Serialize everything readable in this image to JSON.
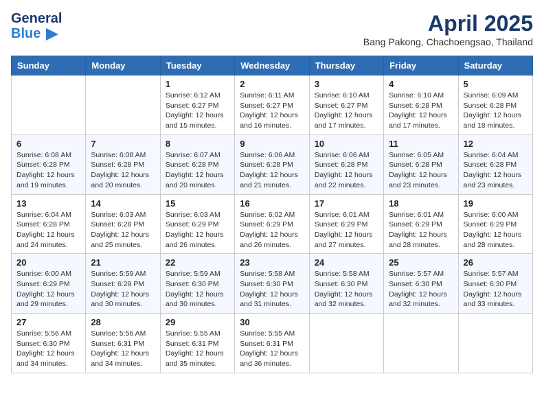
{
  "header": {
    "logo_general": "General",
    "logo_blue": "Blue",
    "title": "April 2025",
    "subtitle": "Bang Pakong, Chachoengsao, Thailand"
  },
  "weekdays": [
    "Sunday",
    "Monday",
    "Tuesday",
    "Wednesday",
    "Thursday",
    "Friday",
    "Saturday"
  ],
  "weeks": [
    [
      {
        "day": "",
        "info": ""
      },
      {
        "day": "",
        "info": ""
      },
      {
        "day": "1",
        "info": "Sunrise: 6:12 AM\nSunset: 6:27 PM\nDaylight: 12 hours and 15 minutes."
      },
      {
        "day": "2",
        "info": "Sunrise: 6:11 AM\nSunset: 6:27 PM\nDaylight: 12 hours and 16 minutes."
      },
      {
        "day": "3",
        "info": "Sunrise: 6:10 AM\nSunset: 6:27 PM\nDaylight: 12 hours and 17 minutes."
      },
      {
        "day": "4",
        "info": "Sunrise: 6:10 AM\nSunset: 6:28 PM\nDaylight: 12 hours and 17 minutes."
      },
      {
        "day": "5",
        "info": "Sunrise: 6:09 AM\nSunset: 6:28 PM\nDaylight: 12 hours and 18 minutes."
      }
    ],
    [
      {
        "day": "6",
        "info": "Sunrise: 6:08 AM\nSunset: 6:28 PM\nDaylight: 12 hours and 19 minutes."
      },
      {
        "day": "7",
        "info": "Sunrise: 6:08 AM\nSunset: 6:28 PM\nDaylight: 12 hours and 20 minutes."
      },
      {
        "day": "8",
        "info": "Sunrise: 6:07 AM\nSunset: 6:28 PM\nDaylight: 12 hours and 20 minutes."
      },
      {
        "day": "9",
        "info": "Sunrise: 6:06 AM\nSunset: 6:28 PM\nDaylight: 12 hours and 21 minutes."
      },
      {
        "day": "10",
        "info": "Sunrise: 6:06 AM\nSunset: 6:28 PM\nDaylight: 12 hours and 22 minutes."
      },
      {
        "day": "11",
        "info": "Sunrise: 6:05 AM\nSunset: 6:28 PM\nDaylight: 12 hours and 23 minutes."
      },
      {
        "day": "12",
        "info": "Sunrise: 6:04 AM\nSunset: 6:28 PM\nDaylight: 12 hours and 23 minutes."
      }
    ],
    [
      {
        "day": "13",
        "info": "Sunrise: 6:04 AM\nSunset: 6:28 PM\nDaylight: 12 hours and 24 minutes."
      },
      {
        "day": "14",
        "info": "Sunrise: 6:03 AM\nSunset: 6:28 PM\nDaylight: 12 hours and 25 minutes."
      },
      {
        "day": "15",
        "info": "Sunrise: 6:03 AM\nSunset: 6:29 PM\nDaylight: 12 hours and 26 minutes."
      },
      {
        "day": "16",
        "info": "Sunrise: 6:02 AM\nSunset: 6:29 PM\nDaylight: 12 hours and 26 minutes."
      },
      {
        "day": "17",
        "info": "Sunrise: 6:01 AM\nSunset: 6:29 PM\nDaylight: 12 hours and 27 minutes."
      },
      {
        "day": "18",
        "info": "Sunrise: 6:01 AM\nSunset: 6:29 PM\nDaylight: 12 hours and 28 minutes."
      },
      {
        "day": "19",
        "info": "Sunrise: 6:00 AM\nSunset: 6:29 PM\nDaylight: 12 hours and 28 minutes."
      }
    ],
    [
      {
        "day": "20",
        "info": "Sunrise: 6:00 AM\nSunset: 6:29 PM\nDaylight: 12 hours and 29 minutes."
      },
      {
        "day": "21",
        "info": "Sunrise: 5:59 AM\nSunset: 6:29 PM\nDaylight: 12 hours and 30 minutes."
      },
      {
        "day": "22",
        "info": "Sunrise: 5:59 AM\nSunset: 6:30 PM\nDaylight: 12 hours and 30 minutes."
      },
      {
        "day": "23",
        "info": "Sunrise: 5:58 AM\nSunset: 6:30 PM\nDaylight: 12 hours and 31 minutes."
      },
      {
        "day": "24",
        "info": "Sunrise: 5:58 AM\nSunset: 6:30 PM\nDaylight: 12 hours and 32 minutes."
      },
      {
        "day": "25",
        "info": "Sunrise: 5:57 AM\nSunset: 6:30 PM\nDaylight: 12 hours and 32 minutes."
      },
      {
        "day": "26",
        "info": "Sunrise: 5:57 AM\nSunset: 6:30 PM\nDaylight: 12 hours and 33 minutes."
      }
    ],
    [
      {
        "day": "27",
        "info": "Sunrise: 5:56 AM\nSunset: 6:30 PM\nDaylight: 12 hours and 34 minutes."
      },
      {
        "day": "28",
        "info": "Sunrise: 5:56 AM\nSunset: 6:31 PM\nDaylight: 12 hours and 34 minutes."
      },
      {
        "day": "29",
        "info": "Sunrise: 5:55 AM\nSunset: 6:31 PM\nDaylight: 12 hours and 35 minutes."
      },
      {
        "day": "30",
        "info": "Sunrise: 5:55 AM\nSunset: 6:31 PM\nDaylight: 12 hours and 36 minutes."
      },
      {
        "day": "",
        "info": ""
      },
      {
        "day": "",
        "info": ""
      },
      {
        "day": "",
        "info": ""
      }
    ]
  ]
}
